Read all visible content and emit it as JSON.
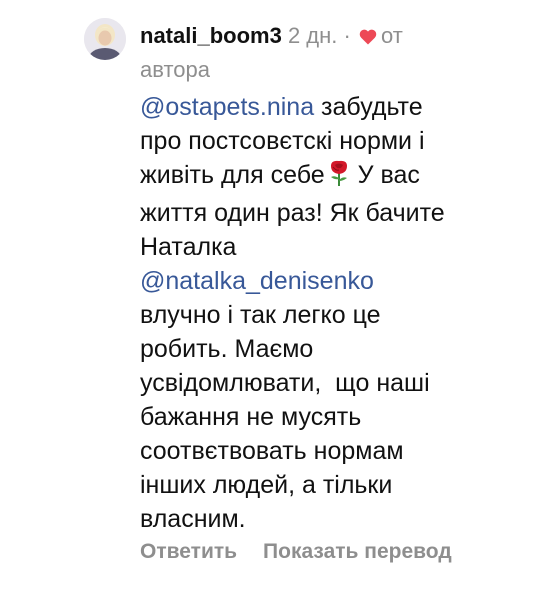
{
  "comment": {
    "username": "natali_boom3",
    "time_ago": "2 дн.",
    "separator": "·",
    "liked_by": "от",
    "liked_by_line2": "автора",
    "icons": {
      "avatar": "user-avatar",
      "like": "heart-icon",
      "emoji": "rose-icon"
    },
    "colors": {
      "mention": "#385898",
      "heart": "#ed4956",
      "meta": "#8e8e8e"
    },
    "lines": {
      "l1_mention": "@ostapets.nina",
      "l1_text": " забудьте",
      "l2": "про постсовєтскі норми і",
      "l3_text": "живіть для себе",
      "l3_after": " У вас",
      "l4": "життя один раз! Як бачите",
      "l5": "Наталка",
      "l6_mention": "@natalka_denisenko",
      "l7": "влучно і так легко це",
      "l8": "робить. Маємо",
      "l9": "усвідомлювати,  що наші",
      "l10": "бажання не мусять",
      "l11": "соотвєтвовать нормам",
      "l12": "інших людей, а тільки",
      "l13": "власним."
    },
    "actions": {
      "reply": "Ответить",
      "translate": "Показать перевод"
    }
  }
}
